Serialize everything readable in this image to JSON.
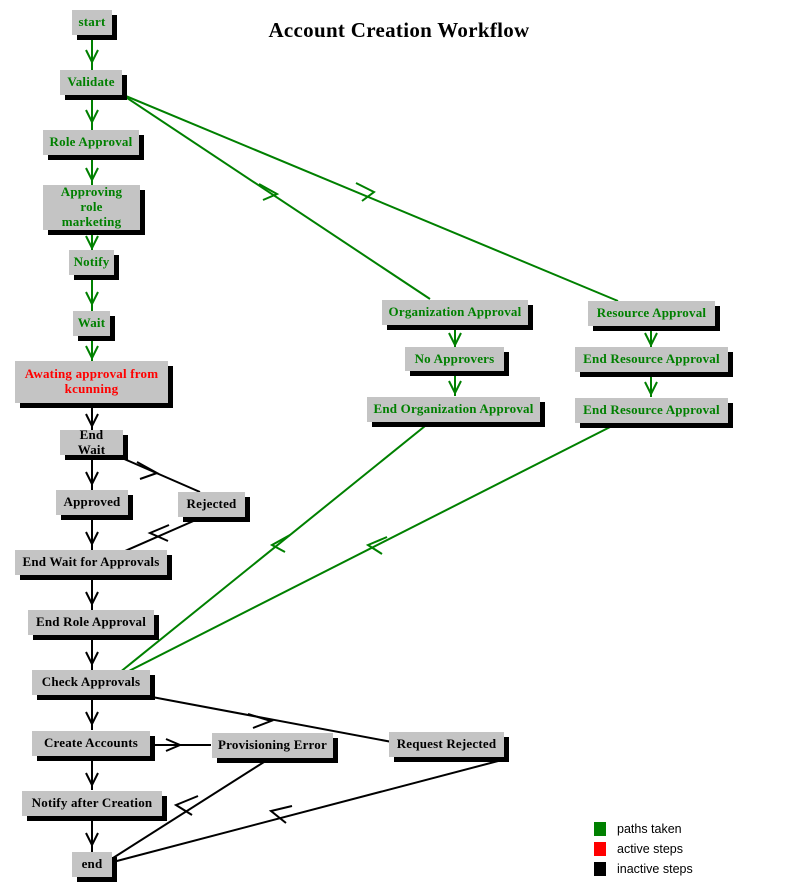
{
  "title": "Account Creation Workflow",
  "colors": {
    "paths_taken": "#008000",
    "active_steps": "#ff0000",
    "inactive_steps": "#000000",
    "node_fill": "#c4c4c4",
    "background": "#ffffff"
  },
  "nodes": {
    "start": "start",
    "validate": "Validate",
    "role_approval": "Role  Approval",
    "approving_role": "Approving role\nmarketing",
    "notify": "Notify",
    "wait": "Wait",
    "awaiting": "Awating approval from\nkcunning",
    "end_wait": "End  Wait",
    "approved": "Approved",
    "rejected": "Rejected",
    "end_wait_for_approvals": "End Wait for  Approvals",
    "end_role_approval": "End Role  Approval",
    "check_approvals": "Check  Approvals",
    "create_accounts": "Create  Accounts",
    "provisioning_error": "Provisioning Error",
    "request_rejected": "Request Rejected",
    "notify_after_creation": "Notify after  Creation",
    "end": "end",
    "organization_approval": "Organization  Approval",
    "no_approvers": "No  Approvers",
    "end_organization_approval": "End Organization  Approval",
    "resource_approval": "Resource  Approval",
    "end_resource_approval_1": "End Resource  Approval",
    "end_resource_approval_2": "End Resource  Approval"
  },
  "legend": {
    "items": [
      {
        "color": "#008000",
        "label": "paths taken"
      },
      {
        "color": "#ff0000",
        "label": "active steps"
      },
      {
        "color": "#000000",
        "label": "inactive steps"
      }
    ]
  }
}
